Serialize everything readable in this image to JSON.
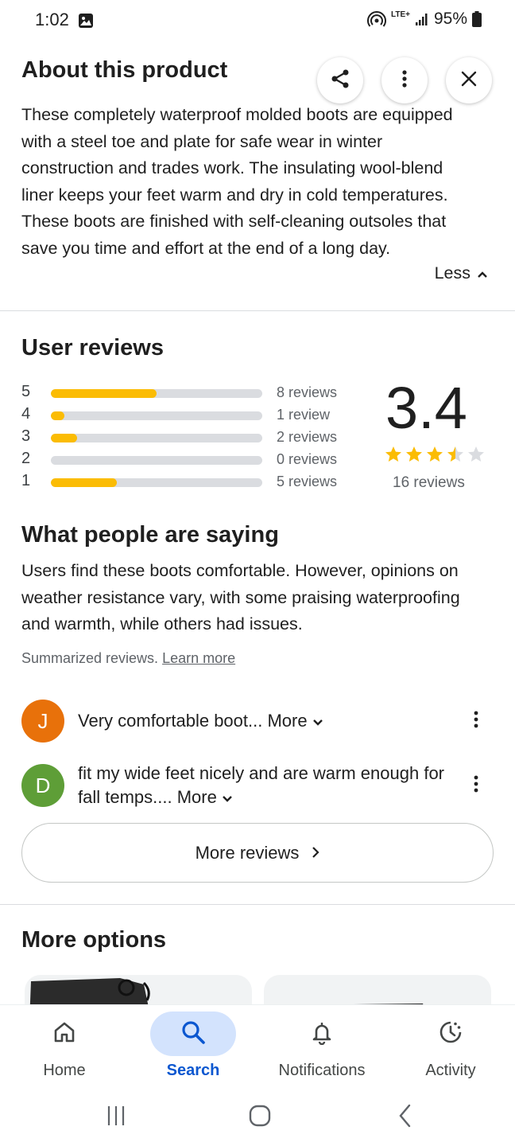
{
  "status_bar": {
    "time": "1:02",
    "battery": "95%",
    "network": "LTE+"
  },
  "about": {
    "title": "About this product",
    "description": "These completely waterproof molded boots are equipped with a steel toe and plate for safe wear in winter construction and trades work. The insulating wool-blend liner keeps your feet warm and dry in cold temperatures. These boots are finished with self-cleaning outsoles that save you time and effort at the end of a long day.",
    "less_label": "Less",
    "actions": [
      "share-icon",
      "more-vert-icon",
      "close-icon"
    ]
  },
  "user_reviews": {
    "title": "User reviews",
    "average": "3.4",
    "average_value": 3.4,
    "total_label": "16 reviews",
    "breakdown": [
      {
        "stars": "5",
        "count_label": "8 reviews",
        "fraction": 0.5
      },
      {
        "stars": "4",
        "count_label": "1 review",
        "fraction": 0.0625
      },
      {
        "stars": "3",
        "count_label": "2 reviews",
        "fraction": 0.125
      },
      {
        "stars": "2",
        "count_label": "0 reviews",
        "fraction": 0
      },
      {
        "stars": "1",
        "count_label": "5 reviews",
        "fraction": 0.3125
      }
    ]
  },
  "summary": {
    "title": "What people are saying",
    "text": "Users find these boots comfortable. However, opinions on weather resistance vary, with some praising waterproofing and warmth, while others had issues.",
    "note": "Summarized reviews.",
    "learn_more": "Learn more"
  },
  "reviews": [
    {
      "initial": "J",
      "color": "#e8710a",
      "text": "Very comfortable boot...",
      "more": "More"
    },
    {
      "initial": "D",
      "color": "#5e9e37",
      "text": "fit my wide feet nicely and are warm enough for fall temps....",
      "more": "More"
    }
  ],
  "more_reviews_label": "More reviews",
  "more_options": {
    "title": "More options"
  },
  "bottom_nav": {
    "active": "Search",
    "items": [
      {
        "label": "Home",
        "icon": "home-icon"
      },
      {
        "label": "Search",
        "icon": "search-icon"
      },
      {
        "label": "Notifications",
        "icon": "bell-icon"
      },
      {
        "label": "Activity",
        "icon": "activity-icon"
      }
    ]
  },
  "colors": {
    "star": "#fbbc04",
    "accent": "#0b57d0",
    "accent_bg": "#d3e3fd"
  }
}
